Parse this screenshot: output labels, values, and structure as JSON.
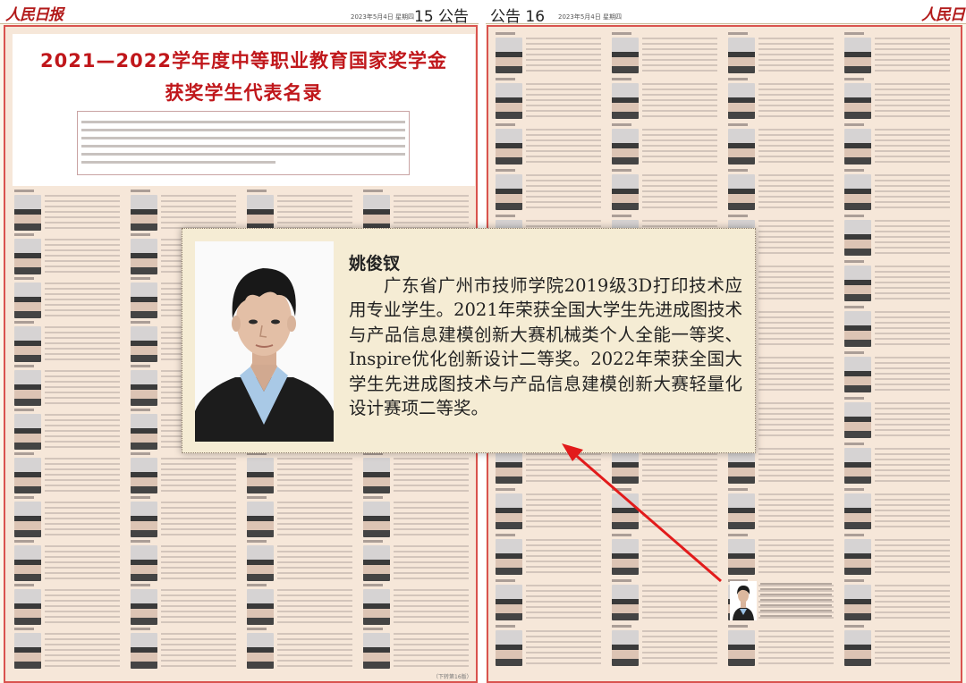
{
  "header": {
    "logo_left": "人民日报",
    "logo_right": "人民日报",
    "date_left": "2023年5月4日 星期四",
    "date_right": "2023年5月4日 星期四",
    "page_left": "15 公告",
    "page_right": "公告 16"
  },
  "left_page": {
    "title_line1": "2021—2022学年度中等职业教育国家奖学金",
    "title_line2": "获奖学生代表名录",
    "footer": "（下转第16版）"
  },
  "callout": {
    "name": "姚俊钗",
    "bio": "广东省广州市技师学院2019级3D打印技术应用专业学生。2021年荣获全国大学生先进成图技术与产品信息建模创新大赛机械类个人全能一等奖、Inspire优化创新设计二等奖。2022年荣获全国大学生先进成图技术与产品信息建模创新大赛轻量化设计赛项二等奖。"
  },
  "colors": {
    "frame_red": "#d9534f",
    "title_red": "#c0171b",
    "arrow_red": "#e21b1b",
    "page_bg": "#f6e7d9",
    "callout_bg": "#f5ecd4"
  }
}
